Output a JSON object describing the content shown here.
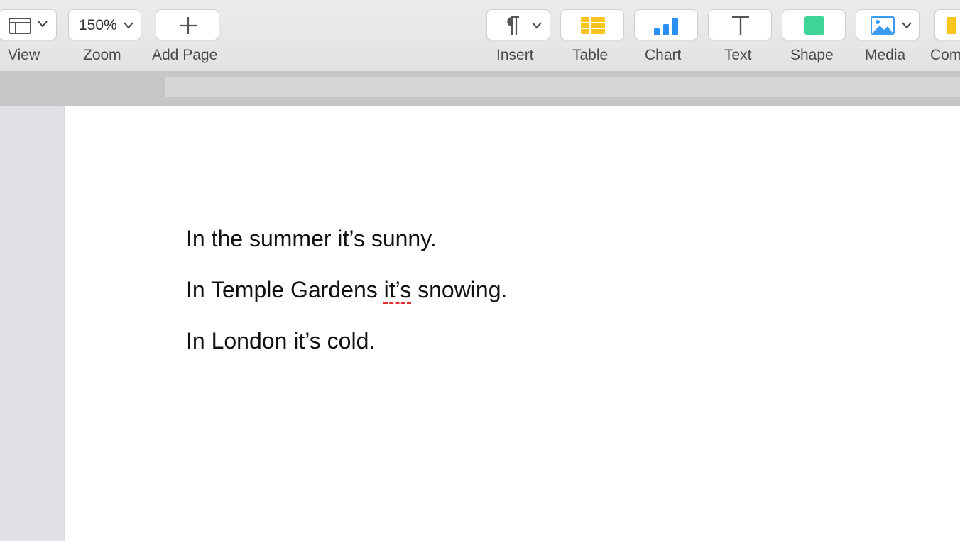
{
  "toolbar": {
    "view": {
      "label": "View",
      "icon": "sidebar-layout-icon"
    },
    "zoom": {
      "label": "Zoom",
      "value": "150%"
    },
    "add_page": {
      "label": "Add Page",
      "icon": "plus-icon"
    },
    "insert": {
      "label": "Insert",
      "icon": "pilcrow-icon"
    },
    "table": {
      "label": "Table",
      "icon": "table-icon",
      "color": "#f7c51d"
    },
    "chart": {
      "label": "Chart",
      "icon": "bar-chart-icon",
      "color": "#2a8ef5"
    },
    "text": {
      "label": "Text",
      "icon": "text-t-icon"
    },
    "shape": {
      "label": "Shape",
      "icon": "shape-square-icon",
      "color": "#3ed49a"
    },
    "media": {
      "label": "Media",
      "icon": "photo-icon",
      "color": "#3b9bf0"
    },
    "comment": {
      "label": "Com",
      "icon": "comment-icon",
      "color": "#f7c51d"
    }
  },
  "document": {
    "line1": "In the summer it’s sunny.",
    "line2_before": "In Temple Gardens ",
    "line2_flagged": "it’s",
    "line2_after": " snowing.",
    "line3": "In London it’s cold."
  }
}
